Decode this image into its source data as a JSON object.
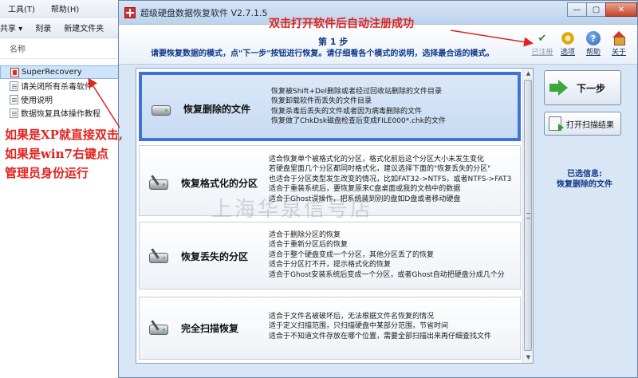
{
  "explorer": {
    "menu": [
      "工具(T)",
      "帮助(H)"
    ],
    "toolbar": [
      "共享 ▾",
      "刻录",
      "新建文件夹"
    ],
    "column_header": "名称",
    "files": [
      {
        "name": "SuperRecovery",
        "icon": "exe-icon",
        "selected": true
      },
      {
        "name": "请关闭所有杀毒软件",
        "icon": "document-icon",
        "selected": false
      },
      {
        "name": "使用说明",
        "icon": "document-icon",
        "selected": false
      },
      {
        "name": "数据恢复具体操作教程",
        "icon": "document-icon",
        "selected": false
      }
    ]
  },
  "red_note": {
    "line1": "如果是XP就直接双击,",
    "line2": "如果是win7右键点",
    "line3": "管理员身份运行"
  },
  "app": {
    "title": "超级硬盘数据恢复软件 V2.7.1.5",
    "window_controls": {
      "minimize": "—",
      "maximize": "▢",
      "close": "✕"
    },
    "annotation": "双击打开软件后自动注册成功",
    "step_title": "第 1 步",
    "step_desc": "请要恢复数据的模式，点\"下一步\"按钮进行恢复。请仔细看各个模式的说明，选择最合适的模式。",
    "top_icons": [
      {
        "label": "已注册",
        "icon": "registered-icon",
        "disabled": true
      },
      {
        "label": "选项",
        "icon": "options-gear-icon",
        "disabled": false
      },
      {
        "label": "帮助",
        "icon": "help-icon",
        "disabled": false
      },
      {
        "label": "关于",
        "icon": "about-house-icon",
        "disabled": false
      }
    ],
    "options": [
      {
        "title": "恢复删除的文件",
        "icon": "disk-icon",
        "lines": [
          "恢复被Shift+Del删除或者经过回收站删除的文件目录",
          "恢复卸载软件而丢失的文件目录",
          "恢复杀毒后丢失的文件或者因为病毒删除的文件",
          "恢复做了ChkDsk磁盘检查后变成FILE000*.chk的文件"
        ]
      },
      {
        "title": "恢复格式化的分区",
        "icon": "disk-repair-icon",
        "lines": [
          "适合恢复单个被格式化的分区，格式化前后这个分区大小未发生变化",
          "若硬盘里面几个分区都同时格式化，建议选择下面的\"恢复丢失的分区\"",
          "也适合于分区类型发生改变的情况，比如FAT32->NTFS，或者NTFS->FAT3",
          "适合于重装系统后，要恢复原来C盘桌面或我的文档中的数据",
          "适合于Ghost误操作，把系统装到别的盘如D盘或者移动硬盘"
        ]
      },
      {
        "title": "恢复丢失的分区",
        "icon": "disk-search-icon",
        "lines": [
          "适合于删除分区的恢复",
          "适合于重新分区后的恢复",
          "适合于整个硬盘变成一个分区，其他分区丢了的恢复",
          "适合于分区打不开，提示格式化的恢复",
          "适合于Ghost安装系统后变成一个分区，或者Ghost自动把硬盘分成几个分"
        ]
      },
      {
        "title": "完全扫描恢复",
        "icon": "disk-scan-icon",
        "lines": [
          "适合于文件名被破坏后，无法根据文件名恢复的情况",
          "适于定义扫描范围，只扫描硬盘中某部分范围，节省时间",
          "适合于不知道文件存放在哪个位置，需要全部扫描出来再仔细查找文件"
        ]
      }
    ],
    "next_button": "下一步",
    "open_scan_button": "打开扫描结果",
    "selected_info_label": "已选信息:",
    "selected_info_value": "恢复删除的文件",
    "watermark": "上海华泉信号店"
  },
  "colors": {
    "annotation_red": "#e1231e",
    "selection_blue": "#3e73d9",
    "text_blue": "#123a8a"
  }
}
